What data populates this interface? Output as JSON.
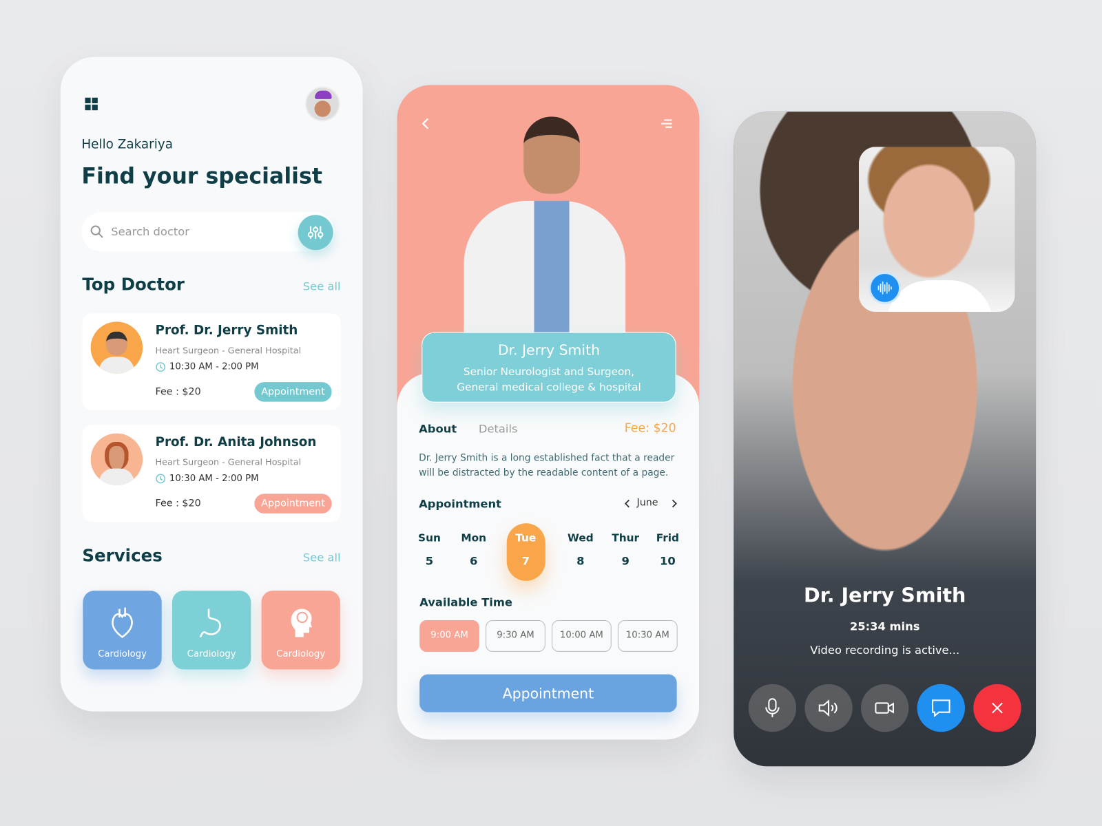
{
  "screen1": {
    "greeting": "Hello Zakariya",
    "title": "Find your specialist",
    "search_placeholder": "Search doctor",
    "top_doctor": {
      "heading": "Top Doctor",
      "see_all": "See all"
    },
    "doctors": [
      {
        "name": "Prof. Dr. Jerry Smith",
        "specialty": "Heart Surgeon - General Hospital",
        "hours": "10:30 AM - 2:00 PM",
        "fee": "Fee : $20",
        "button": "Appointment",
        "button_color": "#74c9d1"
      },
      {
        "name": "Prof. Dr. Anita Johnson",
        "specialty": "Heart Surgeon - General Hospital",
        "hours": "10:30 AM - 2:00 PM",
        "fee": "Fee : $20",
        "button": "Appointment",
        "button_color": "#f9a595"
      }
    ],
    "services": {
      "heading": "Services",
      "see_all": "See all",
      "items": [
        {
          "label": "Cardiology",
          "color": "#6fa5e0",
          "icon": "heart-icon"
        },
        {
          "label": "Cardiology",
          "color": "#7dd0d6",
          "icon": "stomach-icon"
        },
        {
          "label": "Cardiology",
          "color": "#f9a595",
          "icon": "brain-icon"
        }
      ]
    }
  },
  "screen2": {
    "doctor_name": "Dr. Jerry Smith",
    "doctor_title_line1": "Senior Neurologist and Surgeon,",
    "doctor_title_line2": "General medical college & hospital",
    "tabs": [
      "About",
      "Details"
    ],
    "fee": "Fee: $20",
    "about": "Dr. Jerry Smith is a long established fact that a reader will be distracted by the readable content of a page.",
    "appointment_heading": "Appointment",
    "month": "June",
    "days": [
      {
        "day": "Sun",
        "date": "5"
      },
      {
        "day": "Mon",
        "date": "6"
      },
      {
        "day": "Tue",
        "date": "7",
        "selected": true
      },
      {
        "day": "Wed",
        "date": "8"
      },
      {
        "day": "Thur",
        "date": "9"
      },
      {
        "day": "Frid",
        "date": "10"
      }
    ],
    "available_time_heading": "Available Time",
    "slots": [
      "9:00 AM",
      "9:30 AM",
      "10:00 AM",
      "10:30 AM"
    ],
    "selected_slot": "9:00 AM",
    "cta": "Appointment"
  },
  "screen3": {
    "caller": "Dr. Jerry Smith",
    "duration": "25:34 mins",
    "status": "Video recording is active...",
    "controls": [
      "microphone-icon",
      "speaker-icon",
      "video-camera-icon",
      "chat-icon",
      "end-call-icon"
    ]
  },
  "colors": {
    "teal": "#74c9d1",
    "salmon": "#f9a595",
    "orange": "#f9a54a",
    "blue": "#6aa4e0",
    "dark": "#0f3e46",
    "end_call": "#f5333f",
    "chat": "#1f8ff0"
  }
}
